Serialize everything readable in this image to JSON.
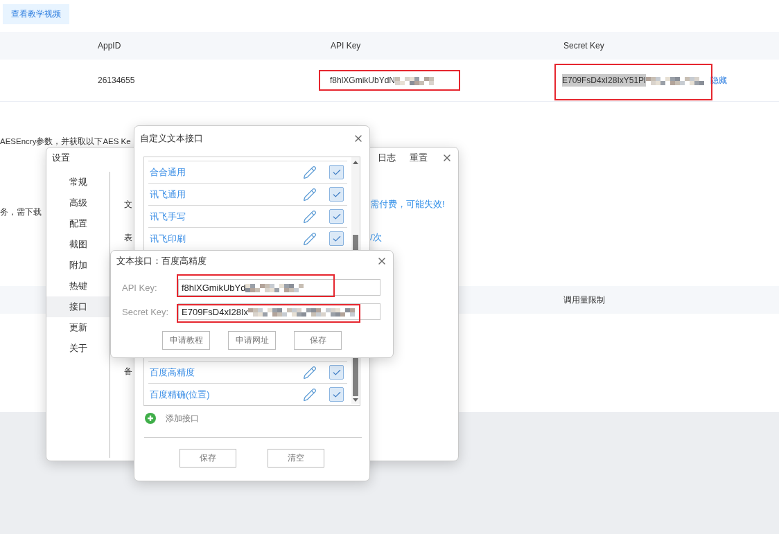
{
  "page": {
    "video_button": "查看教学视频",
    "table": {
      "columns": [
        "AppID",
        "API Key",
        "Secret Key"
      ],
      "rows": [
        {
          "app_id": "26134655",
          "api_key": "f8hlXGmikUbYdN",
          "api_key_highlighted": true,
          "secret_key": "E709FsD4xI28IxY51Pl",
          "secret_key_highlighted": true,
          "action": "隐藏"
        }
      ]
    },
    "notes": [
      "AESEncry参数，并获取以下AES Ke",
      "务，需下载"
    ],
    "quota_table": {
      "columns": [
        "调用量限制"
      ]
    }
  },
  "settings_window": {
    "title": "设置",
    "actions": [
      "日志",
      "重置"
    ],
    "menu": [
      {
        "label": "常规",
        "selected": false
      },
      {
        "label": "高级",
        "selected": false
      },
      {
        "label": "配置",
        "selected": false
      },
      {
        "label": "截图",
        "selected": false
      },
      {
        "label": "附加",
        "selected": false
      },
      {
        "label": "热键",
        "selected": false
      },
      {
        "label": "接口",
        "selected": true
      },
      {
        "label": "更新",
        "selected": false
      },
      {
        "label": "关于",
        "selected": false
      }
    ],
    "content": [
      {
        "label": "文",
        "note": "需付费，可能失效!"
      },
      {
        "label": "表",
        "note": "/次"
      },
      {
        "label": "备"
      }
    ]
  },
  "custom_window": {
    "title": "自定义文本接口",
    "upper_rows": [
      {
        "name": "合合通用",
        "checked": true
      },
      {
        "name": "讯飞通用",
        "checked": true
      },
      {
        "name": "讯飞手写",
        "checked": true
      },
      {
        "name": "讯飞印刷",
        "checked": true
      }
    ],
    "lower_rows": [
      {
        "name": "百度高精度",
        "checked": true
      },
      {
        "name": "百度精确(位置)",
        "checked": true
      }
    ],
    "add_label": "添加接口",
    "buttons": [
      "保存",
      "清空"
    ]
  },
  "baidu_dialog": {
    "title": "文本接口：百度高精度",
    "fields": [
      {
        "label": "API Key:",
        "value": "f8hlXGmikUbYd",
        "highlighted": true
      },
      {
        "label": "Secret Key:",
        "value": "E709FsD4xI28Ix",
        "highlighted": true
      }
    ],
    "buttons": [
      "申请教程",
      "申请网址",
      "保存"
    ]
  }
}
